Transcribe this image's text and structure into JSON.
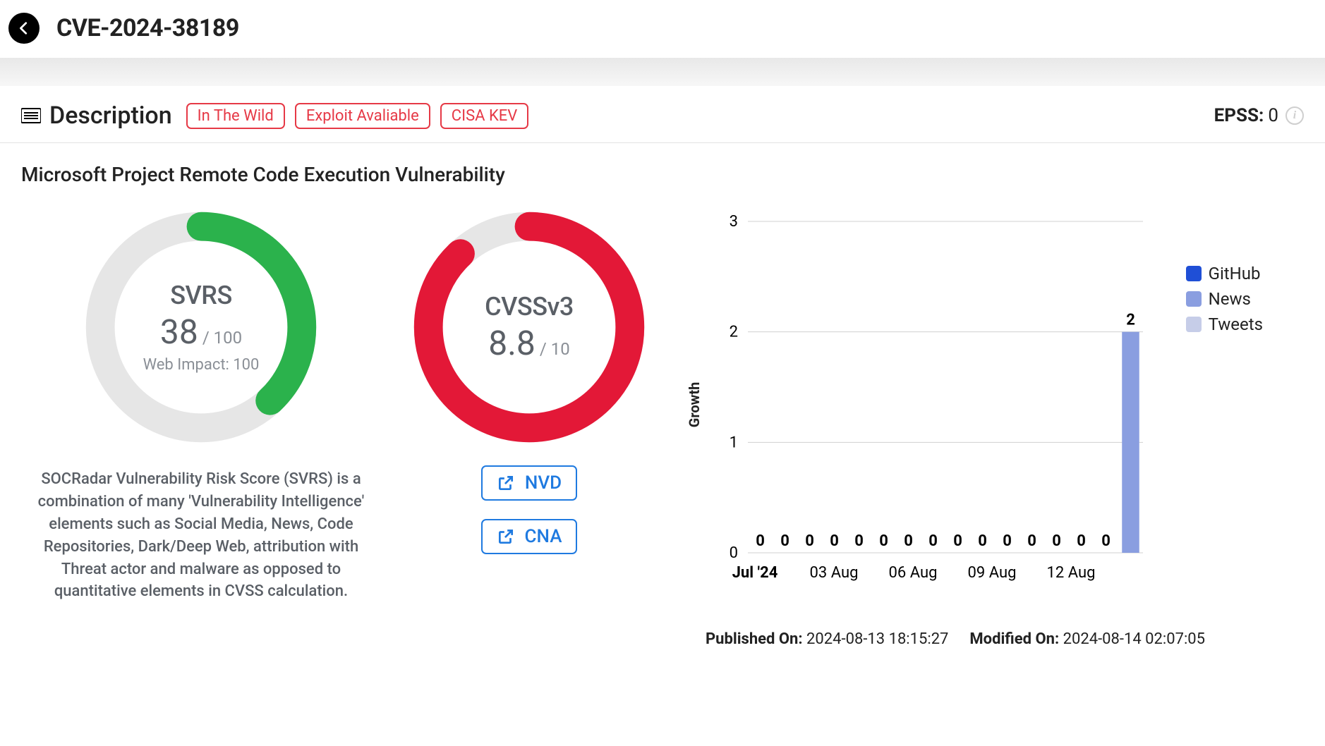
{
  "header": {
    "cve_id": "CVE-2024-38189"
  },
  "description_section": {
    "title": "Description",
    "tags": [
      "In The Wild",
      "Exploit Avaliable",
      "CISA KEV"
    ],
    "epss_label": "EPSS:",
    "epss_value": "0"
  },
  "vulnerability_name": "Microsoft Project Remote Code Execution Vulnerability",
  "svrs": {
    "label": "SVRS",
    "value": "38",
    "max": "/ 100",
    "sub": "Web Impact: 100",
    "description": "SOCRadar Vulnerability Risk Score (SVRS) is a combination of many 'Vulnerability Intelligence' elements such as Social Media, News, Code Repositories, Dark/Deep Web, attribution with Threat actor and malware as opposed to quantitative elements in CVSS calculation.",
    "percent": 38,
    "color": "#2bb24c"
  },
  "cvss": {
    "label": "CVSSv3",
    "value": "8.8",
    "max": "/ 10",
    "percent": 88,
    "color": "#e31837",
    "links": [
      "NVD",
      "CNA"
    ]
  },
  "chart_data": {
    "type": "bar",
    "ylabel": "Growth",
    "ylim": [
      0,
      3
    ],
    "yticks": [
      0,
      1,
      2,
      3
    ],
    "categories": [
      "Jul '24",
      "",
      "03 Aug",
      "",
      "06 Aug",
      "",
      "09 Aug",
      "",
      "12 Aug",
      ""
    ],
    "bar_values": [
      0,
      0,
      0,
      0,
      0,
      0,
      0,
      0,
      0,
      0,
      0,
      0,
      0,
      0,
      0,
      2
    ],
    "series": [
      {
        "name": "GitHub",
        "color": "#1f4fd6"
      },
      {
        "name": "News",
        "color": "#8a9ee0"
      },
      {
        "name": "Tweets",
        "color": "#c6cde8"
      }
    ]
  },
  "dates": {
    "published_label": "Published On:",
    "published_value": "2024-08-13 18:15:27",
    "modified_label": "Modified On:",
    "modified_value": "2024-08-14 02:07:05"
  }
}
